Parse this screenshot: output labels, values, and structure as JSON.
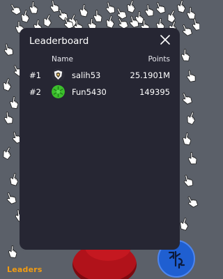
{
  "leaderboard": {
    "title": "Leaderboard",
    "columns": {
      "name": "Name",
      "points": "Points"
    },
    "rows": [
      {
        "rank": "#1",
        "name": "salih53",
        "points": "25.1901M",
        "avatar": "shield-avatar-icon"
      },
      {
        "rank": "#2",
        "name": "Fun5430",
        "points": "149395",
        "avatar": "green-leaf-avatar-icon"
      }
    ]
  },
  "hud": {
    "leaders_label": "Leaders"
  },
  "colors": {
    "background": "#5b6069",
    "panel": "#262633",
    "accent_orange": "#f29c12",
    "blue_button": "#1f5fd1",
    "red_blob": "#b1121a"
  }
}
